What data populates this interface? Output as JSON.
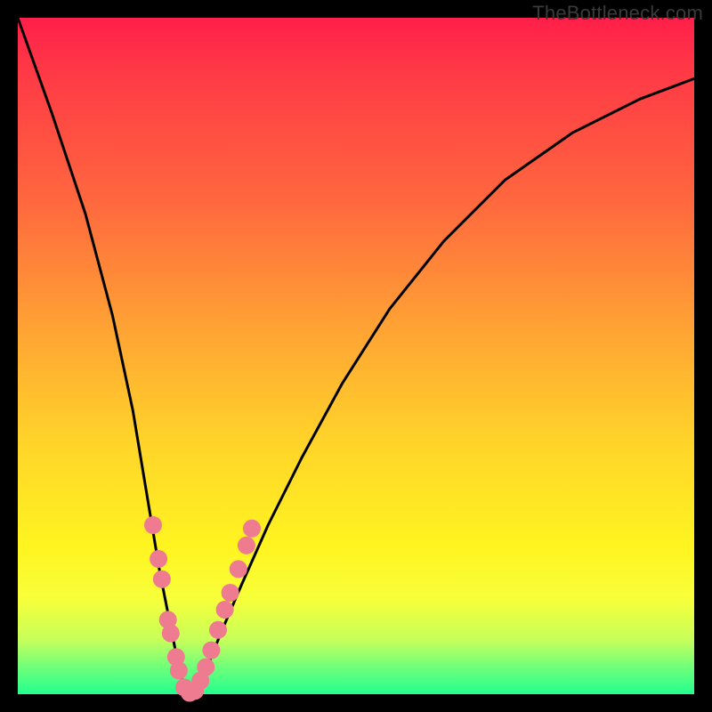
{
  "watermark": "TheBottleneck.com",
  "chart_data": {
    "type": "line",
    "title": "",
    "xlabel": "",
    "ylabel": "",
    "xlim": [
      0,
      100
    ],
    "ylim": [
      0,
      100
    ],
    "grid": false,
    "legend": false,
    "series": [
      {
        "name": "bottleneck-curve",
        "x": [
          0,
          5,
          10,
          14,
          17,
          19,
          21,
          23,
          24,
          25,
          26.5,
          28,
          30,
          33,
          37,
          42,
          48,
          55,
          63,
          72,
          82,
          92,
          100
        ],
        "values": [
          100,
          86,
          71,
          56,
          42,
          30,
          18,
          8,
          3,
          0,
          1,
          4,
          9,
          16,
          25,
          35,
          46,
          57,
          67,
          76,
          83,
          88,
          91
        ]
      }
    ],
    "markers": {
      "name": "highlighted-range",
      "color": "#ee7b8f",
      "points": [
        {
          "x": 20.0,
          "y": 25.0
        },
        {
          "x": 20.8,
          "y": 20.0
        },
        {
          "x": 21.3,
          "y": 17.0
        },
        {
          "x": 22.2,
          "y": 11.0
        },
        {
          "x": 22.6,
          "y": 9.0
        },
        {
          "x": 23.4,
          "y": 5.5
        },
        {
          "x": 23.8,
          "y": 3.5
        },
        {
          "x": 24.6,
          "y": 1.0
        },
        {
          "x": 25.4,
          "y": 0.2
        },
        {
          "x": 26.2,
          "y": 0.5
        },
        {
          "x": 27.0,
          "y": 2.0
        },
        {
          "x": 27.8,
          "y": 4.0
        },
        {
          "x": 28.6,
          "y": 6.5
        },
        {
          "x": 29.6,
          "y": 9.5
        },
        {
          "x": 30.6,
          "y": 12.5
        },
        {
          "x": 31.4,
          "y": 15.0
        },
        {
          "x": 32.6,
          "y": 18.5
        },
        {
          "x": 33.8,
          "y": 22.0
        },
        {
          "x": 34.6,
          "y": 24.5
        }
      ]
    }
  },
  "colors": {
    "curve_stroke": "#000000",
    "marker_fill": "#ee7b8f"
  }
}
